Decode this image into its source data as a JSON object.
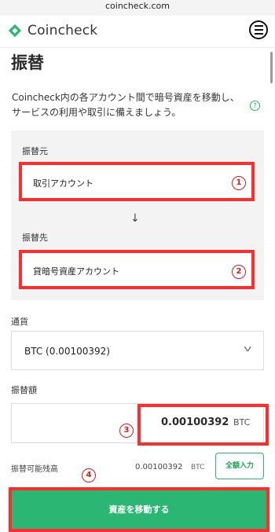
{
  "browser": {
    "url": "coincheck.com"
  },
  "header": {
    "logo_text": "Coincheck",
    "menu_icon": "hamburger-menu-icon"
  },
  "page": {
    "title": "振替",
    "description": "Coincheck内の各アカウント間で暗号資産を移動し、サービスの利用や取引に備えましょう。",
    "help_icon": "question-circle-icon"
  },
  "transfer": {
    "from_label": "振替元",
    "from_account": "取引アカウント",
    "arrow": "↓",
    "to_label": "振替先",
    "to_account": "貸暗号資産アカウント"
  },
  "currency": {
    "label": "通貨",
    "selected": "BTC (0.00100392)"
  },
  "amount": {
    "label": "振替額",
    "value": "0.00100392",
    "unit": "BTC"
  },
  "available": {
    "label": "振替可能残高",
    "value": "0.00100392",
    "unit": "BTC",
    "full_button": "全額入力"
  },
  "submit": {
    "label": "資産を移動する"
  },
  "markers": {
    "m1": "1",
    "m2": "2",
    "m3": "3",
    "m4": "4"
  },
  "colors": {
    "brand_green": "#2bb673",
    "highlight_red": "#ff2d2d",
    "marker_red": "#d21d1d"
  }
}
